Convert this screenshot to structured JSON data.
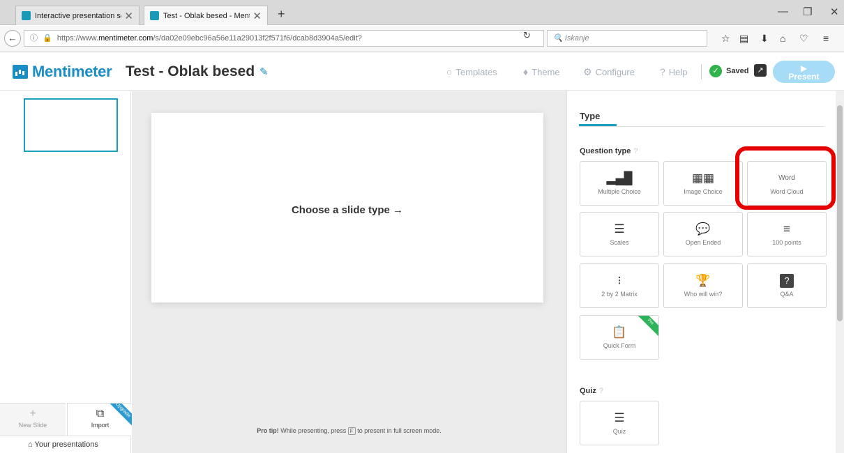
{
  "browser": {
    "tabs": [
      {
        "label": "Interactive presentation so...",
        "active": false
      },
      {
        "label": "Test - Oblak besed - Ment...",
        "active": true
      }
    ],
    "new_tab": "+",
    "url_prefix": "https://www.",
    "url_domain": "mentimeter.com",
    "url_path": "/s/da02e09ebc96a56e11a29013f2f571f6/dcab8d3904a5/edit?",
    "search_placeholder": "Iskanje"
  },
  "header": {
    "logo": "Mentimeter",
    "title": "Test - Oblak besed",
    "nav": [
      {
        "label": "Templates",
        "icon": "lightbulb-icon",
        "glyph": "💡"
      },
      {
        "label": "Theme",
        "icon": "droplet-icon",
        "glyph": "💧"
      },
      {
        "label": "Configure",
        "icon": "gear-icon",
        "glyph": "⚙"
      },
      {
        "label": "Help",
        "icon": "question-icon",
        "glyph": "?"
      }
    ],
    "saved": "Saved",
    "present": "Present"
  },
  "rail": {
    "new_slide": "New Slide",
    "import": "Import",
    "import_badge": "Upgrade",
    "your_presentations": "Your presentations"
  },
  "canvas": {
    "choose": "Choose a slide type →",
    "protip_bold": "Pro tip!",
    "protip_pre": "While presenting, press",
    "protip_key": "F",
    "protip_post": "to present in full screen mode."
  },
  "panel": {
    "tab": "Type",
    "question_type": "Question type",
    "quiz": "Quiz",
    "help": "?",
    "question_cards": [
      {
        "label": "Multiple Choice",
        "icon": "bar-chart-icon",
        "glyph": "▂▄█"
      },
      {
        "label": "Image Choice",
        "icon": "image-bars-icon",
        "glyph": "▦▦"
      },
      {
        "label": "Word Cloud",
        "icon": "word-cloud-icon",
        "glyph": "Word"
      },
      {
        "label": "Scales",
        "icon": "sliders-icon",
        "glyph": "☰"
      },
      {
        "label": "Open Ended",
        "icon": "speech-bubble-icon",
        "glyph": "💬"
      },
      {
        "label": "100 points",
        "icon": "bars-icon",
        "glyph": "≡"
      },
      {
        "label": "2 by 2 Matrix",
        "icon": "matrix-icon",
        "glyph": "⁝"
      },
      {
        "label": "Who will win?",
        "icon": "trophy-icon",
        "glyph": "🏆"
      },
      {
        "label": "Q&A",
        "icon": "qa-icon",
        "glyph": "?"
      },
      {
        "label": "Quick Form",
        "icon": "form-icon",
        "glyph": "📋",
        "badge": "Pro"
      }
    ],
    "quiz_cards": [
      {
        "label": "Quiz",
        "icon": "quiz-list-icon",
        "glyph": "☰"
      }
    ]
  },
  "colors": {
    "brand": "#1a8ec4",
    "accent": "#1a9fbf",
    "saved_green": "#2fb34a",
    "present": "#a6dcf5",
    "highlight": "#e60000"
  }
}
